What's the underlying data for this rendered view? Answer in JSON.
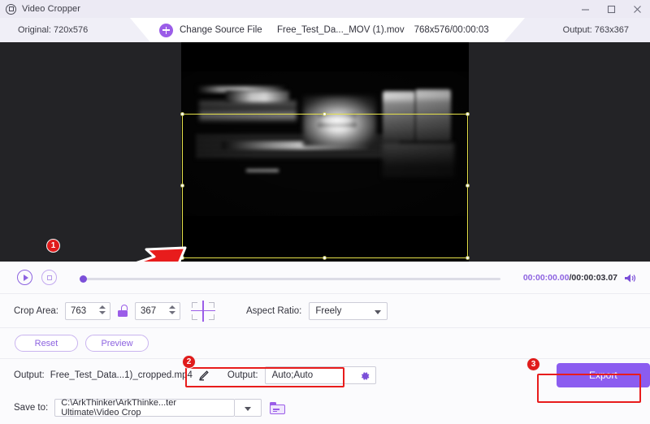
{
  "window": {
    "title": "Video Cropper",
    "app_icon": "crop-circle-icon",
    "minimize": "minimize-icon",
    "maximize": "maximize-icon",
    "close": "close-icon"
  },
  "topbar": {
    "original_tab": "Original: 720x576",
    "change_source_label": "Change Source File",
    "source_filename": "Free_Test_Da..._MOV (1).mov",
    "source_meta": "768x576/00:00:03",
    "output_tab": "Output: 763x367"
  },
  "preview": {
    "crop_border_color": "#e6e14a",
    "stage_background": "#232326",
    "video_background": "#000000"
  },
  "transport": {
    "play_label": "play-icon",
    "stop_label": "stop-icon",
    "current_time": "00:00:00.00",
    "total_time": "/00:00:03.07",
    "volume_label": "volume-icon",
    "seek_position_percent": 0
  },
  "crop_controls": {
    "crop_area_label": "Crop Area:",
    "width_value": "763",
    "height_value": "367",
    "lock_state": "unlocked",
    "center_label": "center-crop-icon",
    "aspect_ratio_label": "Aspect Ratio:",
    "aspect_ratio_value": "Freely"
  },
  "actions": {
    "reset_label": "Reset",
    "preview_label": "Preview"
  },
  "output": {
    "file_label": "Output:",
    "file_name": "Free_Test_Data...1)_cropped.mp4",
    "edit_label": "edit-pencil-icon",
    "format_label": "Output:",
    "format_value": "Auto;Auto",
    "settings_label": "gear-icon",
    "save_to_label": "Save to:",
    "save_path": "C:\\ArkThinker\\ArkThinke...ter Ultimate\\Video Crop",
    "browse_label": "folder-icon",
    "export_label": "Export"
  },
  "annotations": {
    "badge_1": "1",
    "badge_2": "2",
    "badge_3": "3",
    "highlight_color": "#e81c1c",
    "arrow_color": "#e81c1c"
  },
  "theme": {
    "accent": "#8b5cf0",
    "accent_light": "#9b5de8",
    "panel_bg": "#fbfbfd",
    "titlebar_bg": "#eceaf4"
  }
}
